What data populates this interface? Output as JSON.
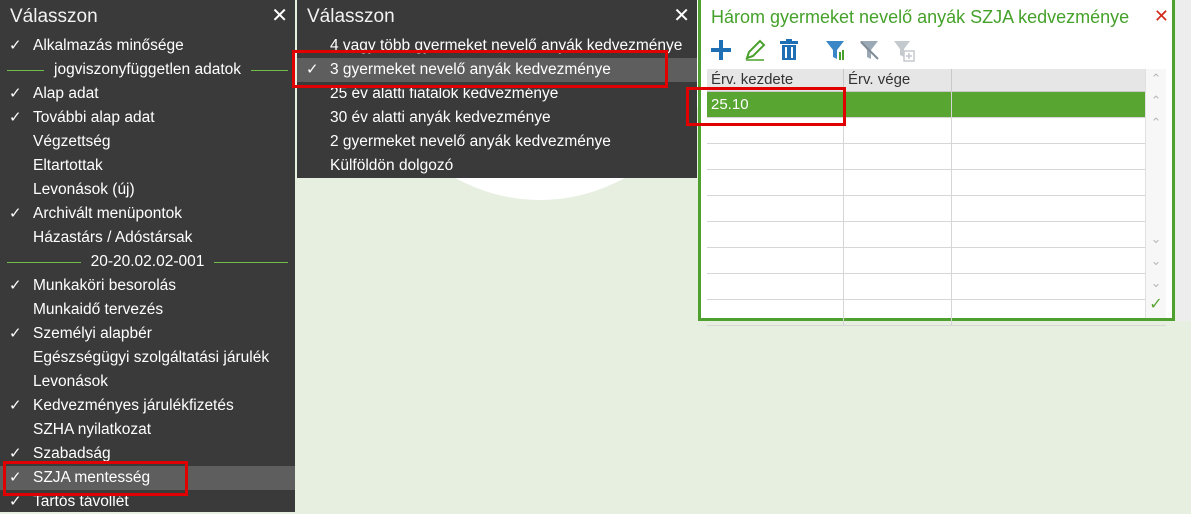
{
  "panel1": {
    "title": "Válasszon",
    "items": [
      {
        "label": "Alkalmazás minősége",
        "checked": true
      },
      {
        "separator": "jogviszonyfüggetlen adatok"
      },
      {
        "label": "Alap adat",
        "checked": true
      },
      {
        "label": "További alap adat",
        "checked": true
      },
      {
        "label": "Végzettség",
        "checked": false
      },
      {
        "label": "Eltartottak",
        "checked": false
      },
      {
        "label": "Levonások (új)",
        "checked": false
      },
      {
        "label": "Archivált menüpontok",
        "checked": true
      },
      {
        "label": "Házastárs / Adóstársak",
        "checked": false
      },
      {
        "separator": "20-20.02.02-001"
      },
      {
        "label": "Munkaköri besorolás",
        "checked": true
      },
      {
        "label": "Munkaidő tervezés",
        "checked": false
      },
      {
        "label": "Személyi alapbér",
        "checked": true
      },
      {
        "label": "Egészségügyi szolgáltatási járulék",
        "checked": false
      },
      {
        "label": "Levonások",
        "checked": false
      },
      {
        "label": "Kedvezményes járulékfizetés",
        "checked": true
      },
      {
        "label": "SZHA nyilatkozat",
        "checked": false
      },
      {
        "label": "Szabadság",
        "checked": true
      },
      {
        "label": "SZJA mentesség",
        "checked": true,
        "selected": true
      },
      {
        "label": "Tartós távollét",
        "checked": true
      }
    ]
  },
  "panel2": {
    "title": "Válasszon",
    "items": [
      {
        "label": "4 vagy több gyermeket nevelő anyák kedvezménye",
        "checked": false
      },
      {
        "label": "3 gyermeket nevelő anyák kedvezménye",
        "checked": true,
        "selected": true
      },
      {
        "label": "25 év alatti fiatalok kedvezménye",
        "checked": false
      },
      {
        "label": "30 év alatti anyák kedvezménye",
        "checked": false
      },
      {
        "label": "2 gyermeket nevelő anyák kedvezménye",
        "checked": false
      },
      {
        "label": "Külföldön dolgozó",
        "checked": false
      }
    ]
  },
  "window3": {
    "title": "Három gyermeket nevelő anyák SZJA kedvezménye",
    "toolbar": [
      "plus-icon",
      "edit-pencil-icon",
      "trash-icon",
      "filter-icon",
      "filter-clear-icon",
      "filter-add-icon"
    ],
    "columns": [
      "Érv. kezdete",
      "Érv. vége"
    ],
    "rows": [
      {
        "start": "25.10",
        "end": ""
      }
    ],
    "empty_rows": 8
  },
  "check_glyph": "✓",
  "close_glyph": "✕",
  "colors": {
    "accent_green": "#58a531",
    "title_green": "#45a12a",
    "highlight_red": "#e00000",
    "panel_dark": "#3a3a3a"
  }
}
